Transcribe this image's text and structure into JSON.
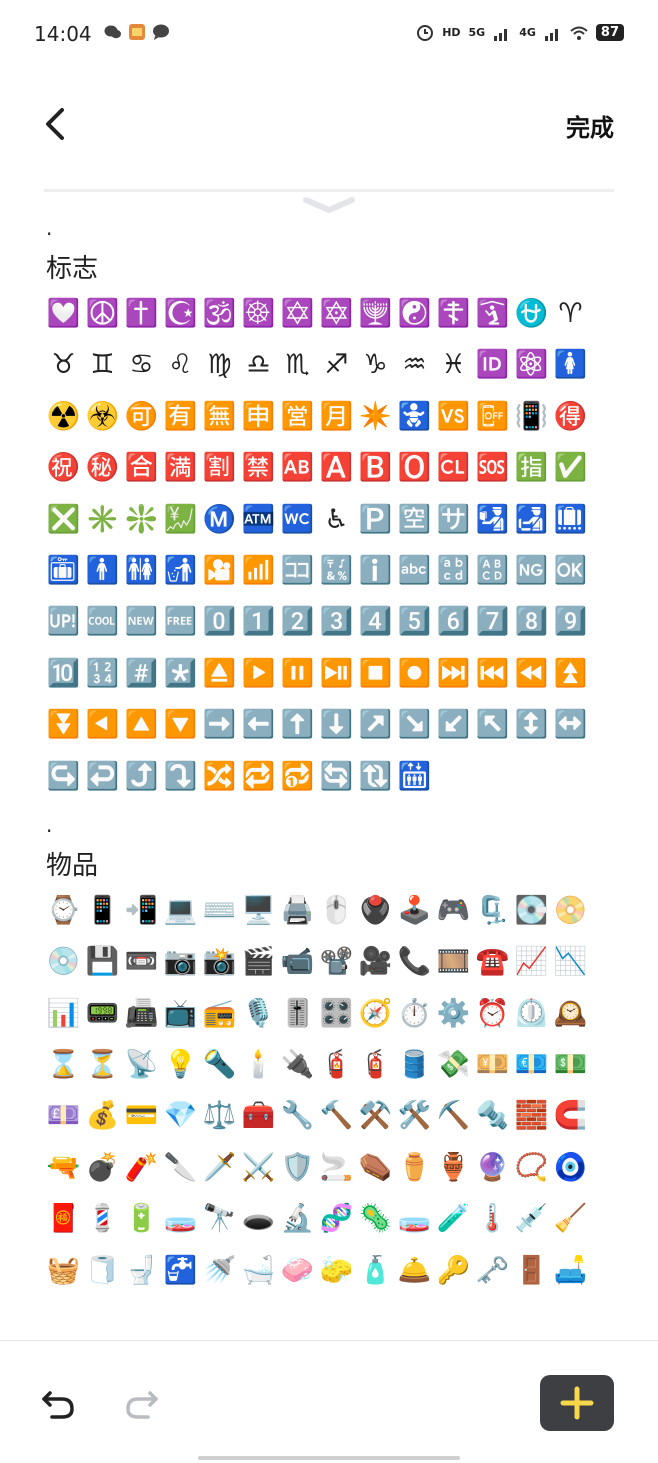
{
  "status": {
    "time": "14:04",
    "left_icons": [
      "wechat-icon",
      "app-icon",
      "message-icon"
    ],
    "right": {
      "hd": "HD",
      "net1": "5G",
      "net2": "4G",
      "battery": "87"
    }
  },
  "topbar": {
    "done_label": "完成"
  },
  "sections": [
    {
      "dot": ".",
      "title": "标志",
      "emojis": [
        "💟",
        "☮️",
        "✝️",
        "☪️",
        "🕉️",
        "☸️",
        "✡️",
        "🔯",
        "🕎",
        "☯️",
        "☦️",
        "🛐",
        "⛎",
        "♈",
        "♉",
        "♊",
        "♋",
        "♌",
        "♍",
        "♎",
        "♏",
        "♐",
        "♑",
        "♒",
        "♓",
        "🆔",
        "⚛️",
        "🚺",
        "☢️",
        "☣️",
        "🉑",
        "🈶",
        "🈚",
        "🈸",
        "🈺",
        "🈷️",
        "✴️",
        "🚼",
        "🆚",
        "📴",
        "📳",
        "🉐",
        "㊗️",
        "㊙️",
        "🈴",
        "🈵",
        "🈹",
        "🈲",
        "🆎",
        "🅰️",
        "🅱️",
        "🅾️",
        "🆑",
        "🆘",
        "🈯",
        "✅",
        "❎",
        "✳️",
        "❇️",
        "💹",
        "Ⓜ️",
        "🏧",
        "🚾",
        "♿",
        "🅿️",
        "🈳",
        "🈂️",
        "🛂",
        "🛃",
        "🛄",
        "🛅",
        "🚹",
        "🚻",
        "🚮",
        "🎦",
        "📶",
        "🈁",
        "🔣",
        "ℹ️",
        "🔤",
        "🔡",
        "🔠",
        "🆖",
        "🆗",
        "🆙",
        "🆒",
        "🆕",
        "🆓",
        "0️⃣",
        "1️⃣",
        "2️⃣",
        "3️⃣",
        "4️⃣",
        "5️⃣",
        "6️⃣",
        "7️⃣",
        "8️⃣",
        "9️⃣",
        "🔟",
        "🔢",
        "#️⃣",
        "*️⃣",
        "⏏️",
        "▶️",
        "⏸️",
        "⏯️",
        "⏹️",
        "⏺️",
        "⏭️",
        "⏮️",
        "⏪",
        "⏫",
        "⏬",
        "◀️",
        "🔼",
        "🔽",
        "➡️",
        "⬅️",
        "⬆️",
        "⬇️",
        "↗️",
        "↘️",
        "↙️",
        "↖️",
        "↕️",
        "↔️",
        "↪️",
        "↩️",
        "⤴️",
        "⤵️",
        "🔀",
        "🔁",
        "🔂",
        "🔄",
        "🔃",
        "🛗"
      ]
    },
    {
      "dot": ".",
      "title": "物品",
      "emojis": [
        "⌚",
        "📱",
        "📲",
        "💻",
        "⌨️",
        "🖥️",
        "🖨️",
        "🖱️",
        "🖲️",
        "🕹️",
        "🎮",
        "🗜️",
        "💽",
        "📀",
        "💿",
        "💾",
        "📼",
        "📷",
        "📸",
        "🎬",
        "📹",
        "📽️",
        "🎥",
        "📞",
        "🎞️",
        "☎️",
        "📈",
        "📉",
        "📊",
        "📟",
        "📠",
        "📺",
        "📻",
        "🎙️",
        "🎚️",
        "🎛️",
        "🧭",
        "⏱️",
        "⚙️",
        "⏰",
        "⏲️",
        "🕰️",
        "⌛",
        "⏳",
        "📡",
        "💡",
        "🔦",
        "🕯️",
        "🔌",
        "🧯",
        "🧯",
        "🛢️",
        "💸",
        "💴",
        "💶",
        "💵",
        "💷",
        "💰",
        "💳",
        "💎",
        "⚖️",
        "🧰",
        "🔧",
        "🔨",
        "⚒️",
        "🛠️",
        "⛏️",
        "🔩",
        "🧱",
        "🧲",
        "🔫",
        "💣",
        "🧨",
        "🔪",
        "🗡️",
        "⚔️",
        "🛡️",
        "🚬",
        "⚰️",
        "⚱️",
        "🏺",
        "🔮",
        "📿",
        "🧿",
        "🧧",
        "💈",
        "🔋",
        "🧫",
        "🔭",
        "🕳️",
        "🔬",
        "🧬",
        "🦠",
        "🧫",
        "🧪",
        "🌡️",
        "💉",
        "🧹",
        "🧺",
        "🧻",
        "🚽",
        "🚰",
        "🚿",
        "🛁",
        "🧼",
        "🧽",
        "🧴",
        "🛎️",
        "🔑",
        "🗝️",
        "🚪",
        "🛋️"
      ]
    }
  ],
  "bottom": {
    "add_label": "+"
  },
  "colors": {
    "accent_yellow": "#f6d84a",
    "add_bg": "#3d3f43"
  }
}
